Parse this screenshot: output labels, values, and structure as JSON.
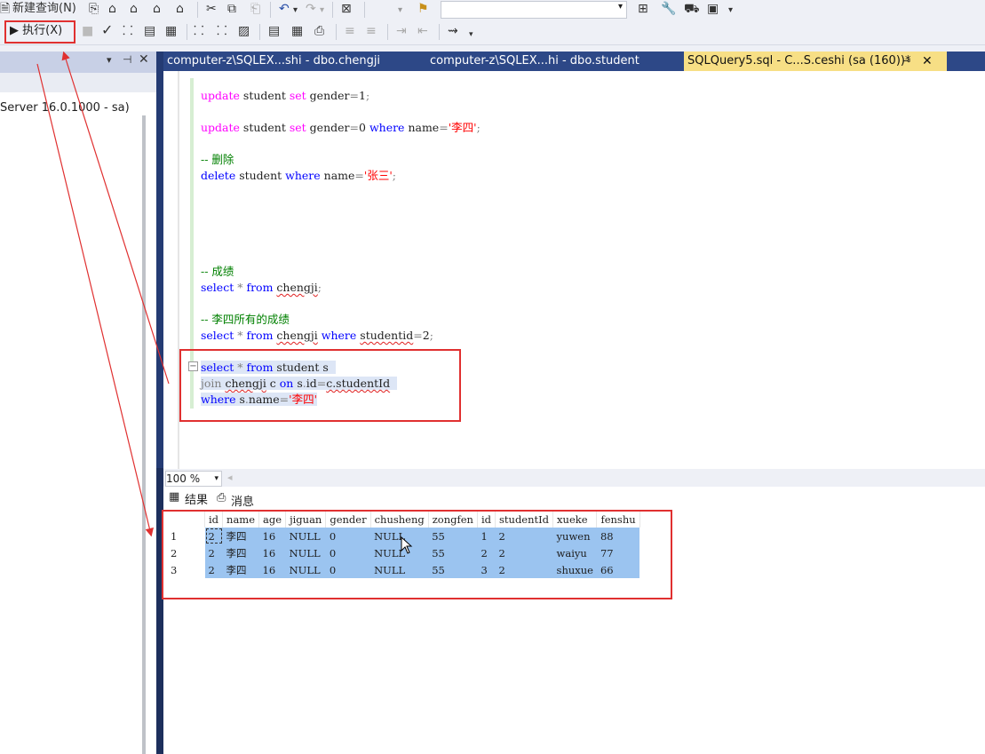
{
  "toolbar": {
    "new_query_label": "新建查询(N)",
    "execute_label": "▶ 执行(X)"
  },
  "left_panel": {
    "server_label": "Server 16.0.1000 - sa)"
  },
  "tabs": [
    {
      "label": "computer-z\\SQLEX...shi - dbo.chengji"
    },
    {
      "label": "computer-z\\SQLEX...hi - dbo.student"
    },
    {
      "label": "SQLQuery5.sql - C...S.ceshi (sa (160))*"
    }
  ],
  "editor": {
    "line1": "update student set gender=1;",
    "line2": "update student set gender=0 where name='李四';",
    "comment_delete": "-- 删除",
    "line3": "delete student where name='张三';",
    "comment_score": "-- 成绩",
    "line4": "select * from chengji;",
    "comment_lisi": "-- 李四所有的成绩",
    "line5": "select * from chengji where studentid=2;",
    "join_l1": "select * from student s",
    "join_l2": "join chengji c on s.id=c.studentId",
    "join_l3": "where s.name='李四'"
  },
  "zoom": "100 %",
  "results_tabs": {
    "results": "结果",
    "messages": "消息"
  },
  "results": {
    "columns": [
      "id",
      "name",
      "age",
      "jiguan",
      "gender",
      "chusheng",
      "zongfen",
      "id",
      "studentId",
      "xueke",
      "fenshu"
    ],
    "rows": [
      {
        "n": "1",
        "cells": [
          "2",
          "李四",
          "16",
          "NULL",
          "0",
          "NULL",
          "55",
          "1",
          "2",
          "yuwen",
          "88"
        ]
      },
      {
        "n": "2",
        "cells": [
          "2",
          "李四",
          "16",
          "NULL",
          "0",
          "NULL",
          "55",
          "2",
          "2",
          "waiyu",
          "77"
        ]
      },
      {
        "n": "3",
        "cells": [
          "2",
          "李四",
          "16",
          "NULL",
          "0",
          "NULL",
          "55",
          "3",
          "2",
          "shuxue",
          "66"
        ]
      }
    ]
  },
  "colors": {
    "annotation": "#e03030",
    "tab_bar": "#2d4887",
    "active_tab": "#f7df85",
    "selection": "#9bc4f0"
  }
}
